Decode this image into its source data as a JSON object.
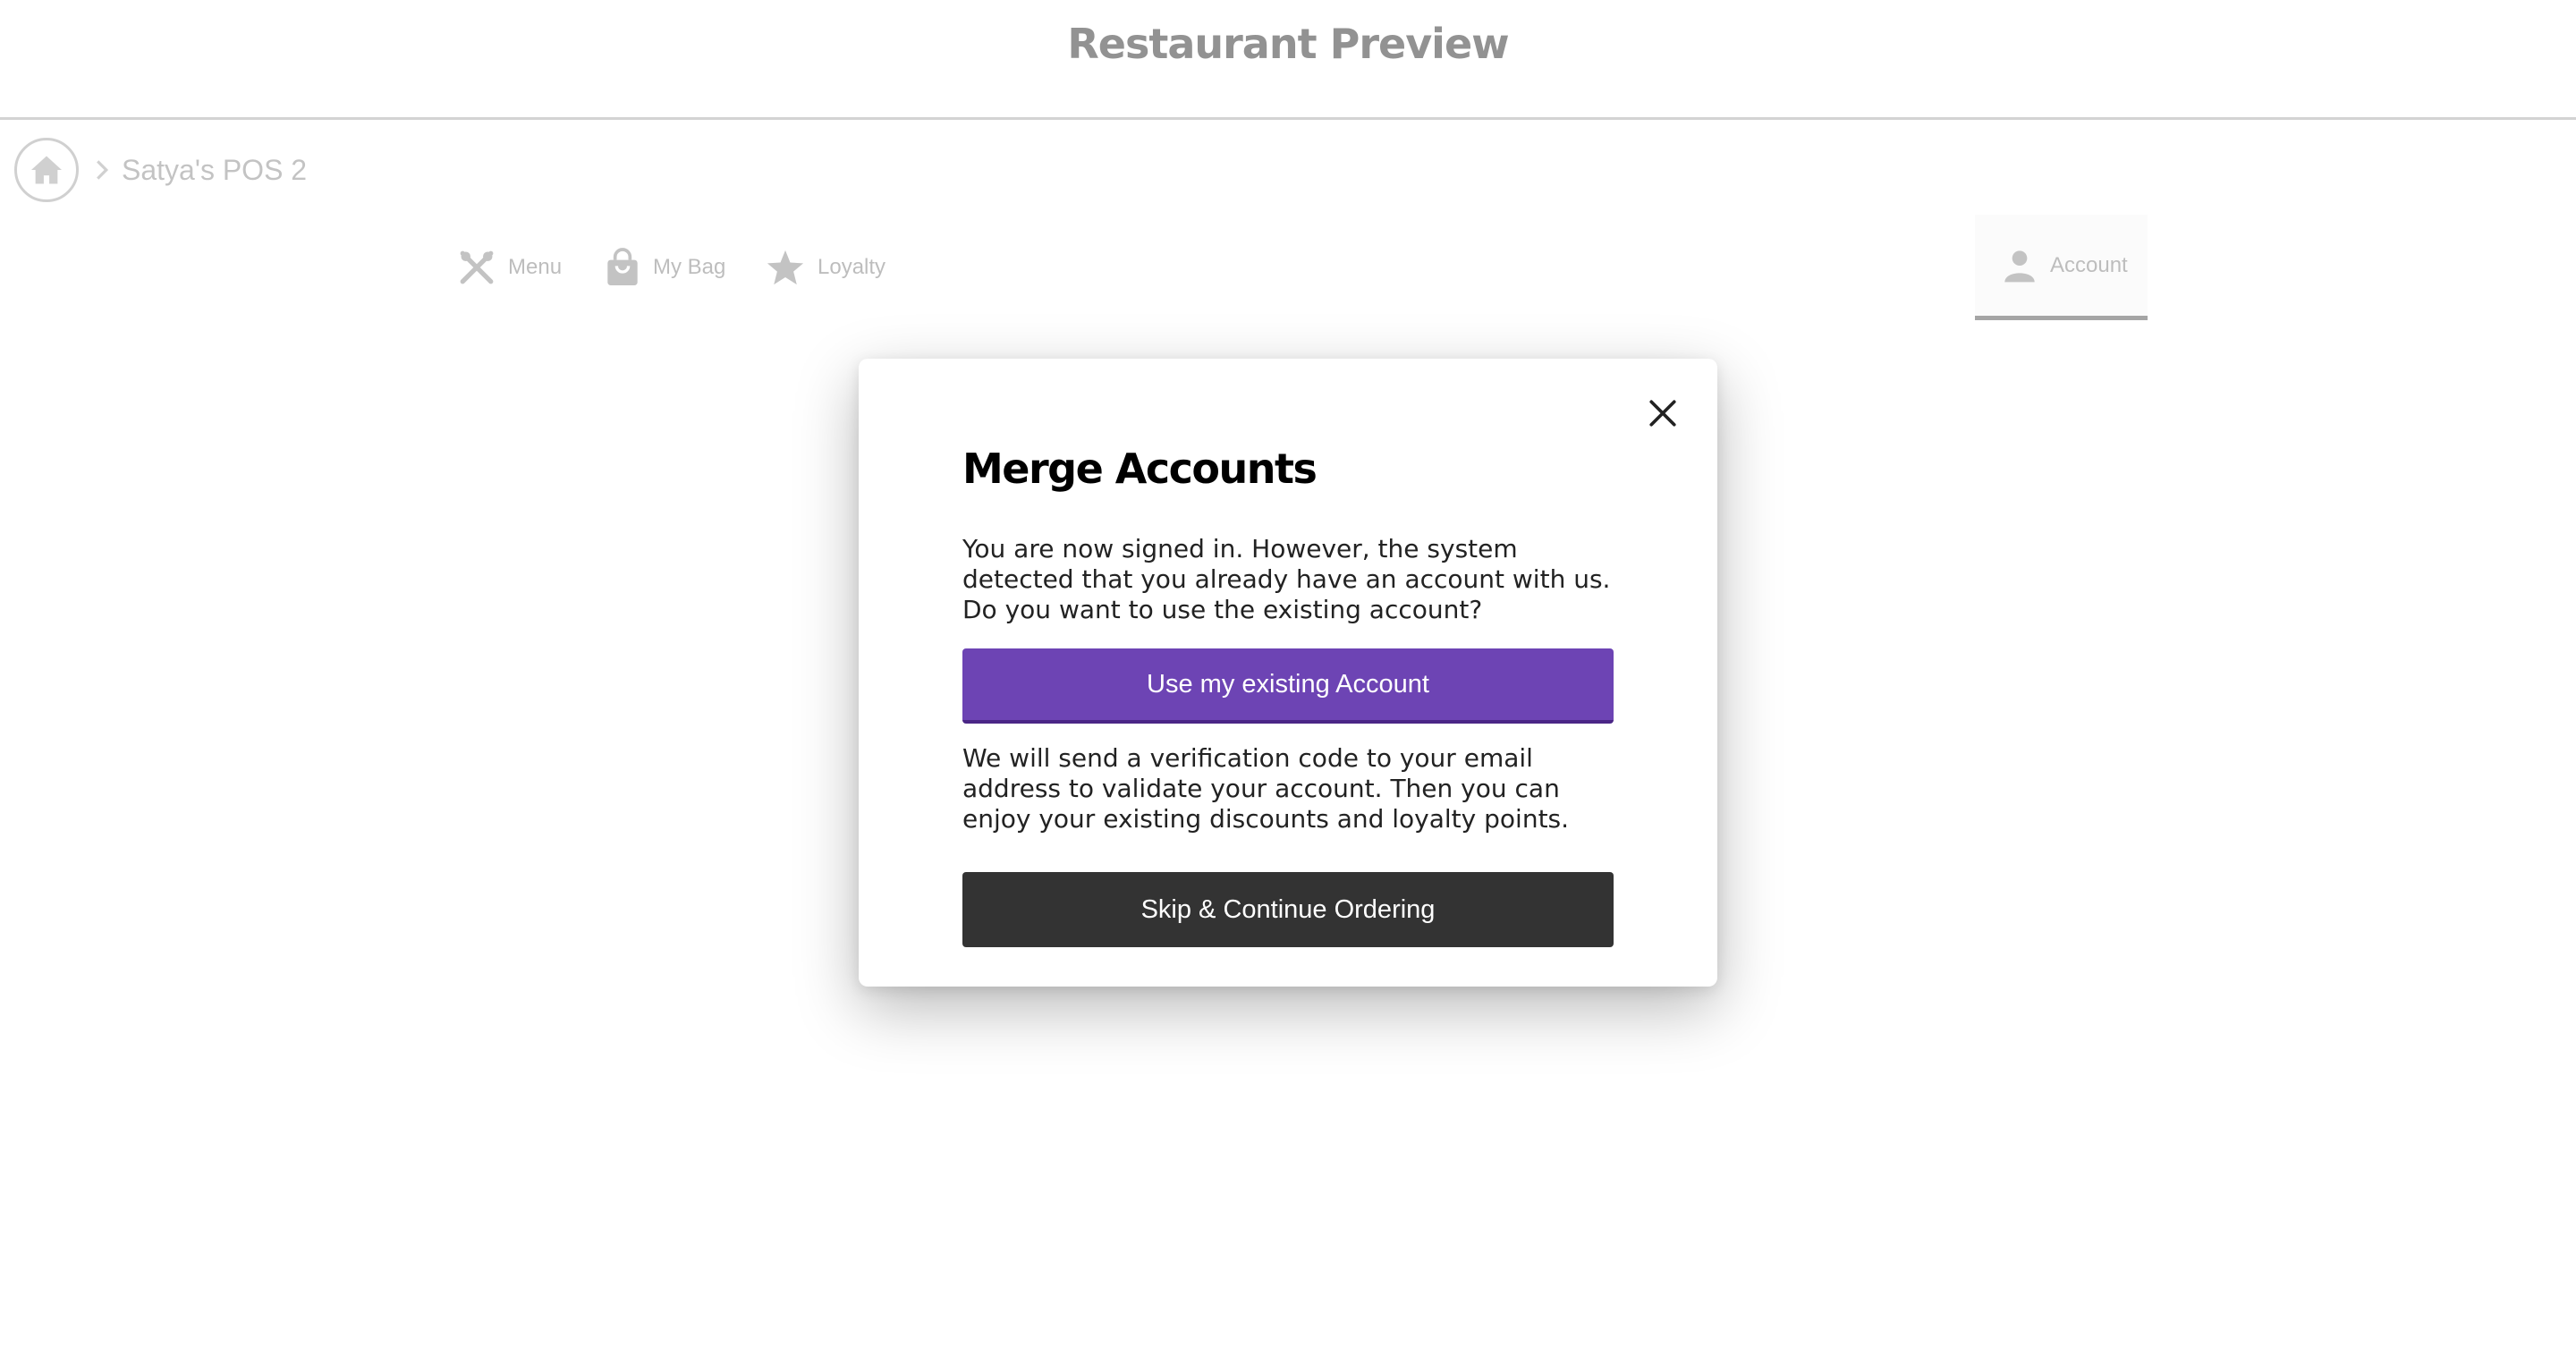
{
  "header": {
    "title": "Restaurant Preview"
  },
  "breadcrumb": {
    "home_icon": "home-icon",
    "separator_icon": "chevron-right-icon",
    "current": "Satya's POS 2"
  },
  "nav": {
    "items": [
      {
        "label": "Menu",
        "icon": "utensils-icon"
      },
      {
        "label": "My Bag",
        "icon": "shopping-bag-icon"
      },
      {
        "label": "Loyalty",
        "icon": "star-icon"
      },
      {
        "label": "Account",
        "icon": "person-icon",
        "active": true
      }
    ]
  },
  "modal": {
    "title": "Merge Accounts",
    "close_icon": "close-icon",
    "message": "You are now signed in. However, the system detected that you already have an account with us. Do you want to use the existing account?",
    "primary_button": "Use my existing Account",
    "secondary_message": "We will send a verification code to your email address to validate your account. Then you can enjoy your existing discounts and loyalty points.",
    "secondary_button": "Skip & Continue Ordering"
  },
  "colors": {
    "primary_button": "#6d44b4",
    "secondary_button": "#333333",
    "active_tab_border": "#000000"
  }
}
